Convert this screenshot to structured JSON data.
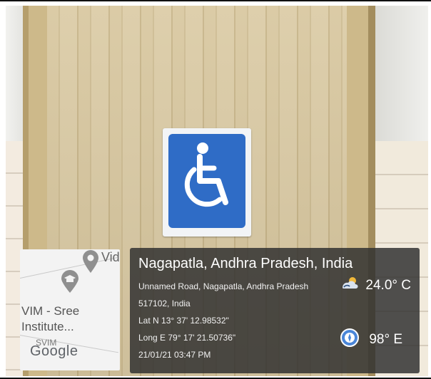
{
  "map": {
    "labels": {
      "vim_sree": "VIM - Sree",
      "institute": "Institute...",
      "svim": "SVIM",
      "google": "Google",
      "vid": "Vid"
    }
  },
  "overlay": {
    "title": "Nagapatla, Andhra Pradesh, India",
    "address_line1": "Unnamed Road, Nagapatla, Andhra Pradesh",
    "address_line2": "517102, India",
    "lat": "Lat N 13° 37' 12.98532\"",
    "long": "Long E 79° 17' 21.50736\"",
    "datetime": "21/01/21 03:47 PM",
    "temperature": "24.0° C",
    "direction": "98° E"
  },
  "sign": {
    "icon": "wheelchair-icon",
    "background": "#2f6cc6"
  },
  "icons": {
    "weather": "weather-icon",
    "compass": "compass-icon",
    "map_pin": "map-pin-icon",
    "graduation": "graduation-cap-icon"
  }
}
